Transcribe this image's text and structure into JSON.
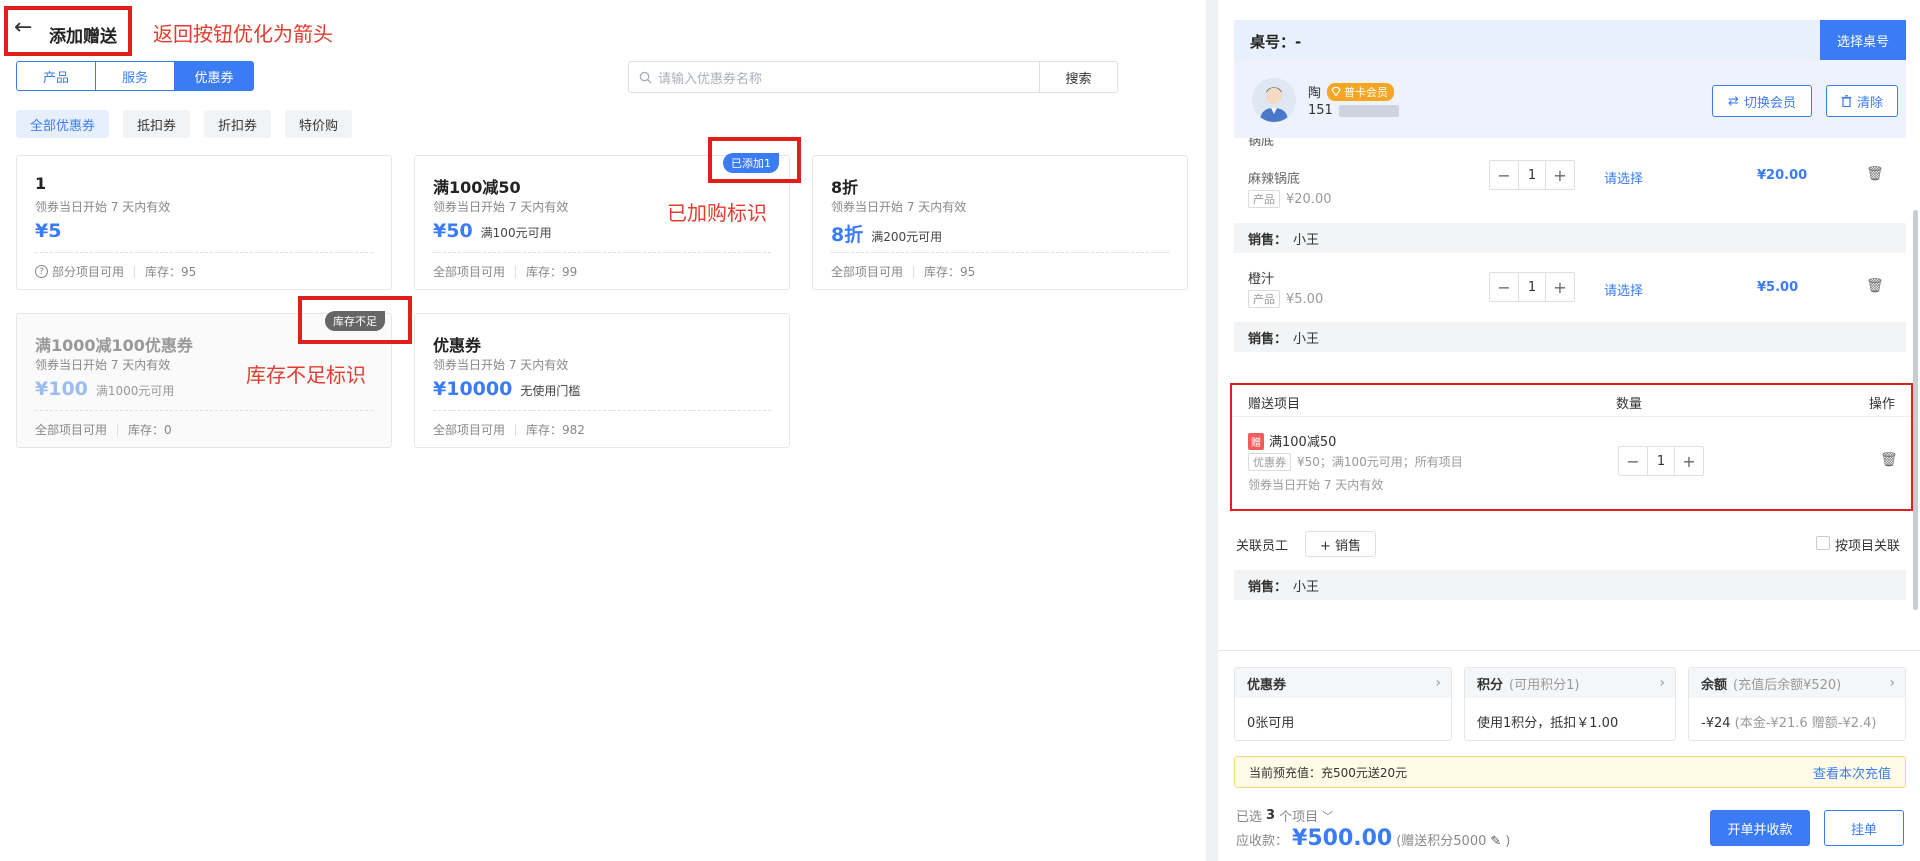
{
  "header": {
    "back_arrow": "←",
    "title": "添加赠送"
  },
  "annotations": {
    "back": "返回按钮优化为箭头",
    "added": "已加购标识",
    "stock": "库存不足标识"
  },
  "tabs": [
    {
      "label": "产品"
    },
    {
      "label": "服务"
    },
    {
      "label": "优惠券",
      "active": true
    }
  ],
  "search": {
    "placeholder": "请输入优惠券名称",
    "button": "搜索"
  },
  "filters": [
    {
      "label": "全部优惠券",
      "active": true
    },
    {
      "label": "抵扣券"
    },
    {
      "label": "折扣券"
    },
    {
      "label": "特价购"
    }
  ],
  "coupons": [
    {
      "title": "1",
      "sub": "领券当日开始 7 天内有效",
      "amount": "¥5",
      "cond": "",
      "scope": "部分项目可用",
      "stock": "库存：95",
      "scope_icon": "question-icon"
    },
    {
      "title": "满100减50",
      "sub": "领券当日开始 7 天内有效",
      "amount": "¥50",
      "cond": "满100元可用",
      "scope": "全部项目可用",
      "stock": "库存：99",
      "badge": "已添加1"
    },
    {
      "title": "8折",
      "sub": "领券当日开始 7 天内有效",
      "amount": "8折",
      "cond": "满200元可用",
      "scope": "全部项目可用",
      "stock": "库存：95"
    },
    {
      "title": "满1000减100优惠券",
      "sub": "领券当日开始 7 天内有效",
      "amount": "¥100",
      "cond": "满1000元可用",
      "scope": "全部项目可用",
      "stock": "库存：0",
      "badge": "库存不足",
      "disabled": true
    },
    {
      "title": "优惠券",
      "sub": "领券当日开始 7 天内有效",
      "amount": "¥10000",
      "cond": "无使用门槛",
      "scope": "全部项目可用",
      "stock": "库存：982"
    }
  ],
  "right": {
    "table_label": "桌号：-",
    "select_table": "选择桌号",
    "member": {
      "name": "陶",
      "level": "普卡会员",
      "phone": "151",
      "switch": "切换会员",
      "clear": "清除"
    },
    "items": [
      {
        "cut_title": "锅底",
        "name": "麻辣锅底",
        "tag": "产品",
        "price": "¥20.00",
        "qty": "1",
        "select": "请选择",
        "total": "¥20.00",
        "sales": "销售：",
        "seller": "小王"
      },
      {
        "name": "橙汁",
        "tag": "产品",
        "price": "¥5.00",
        "qty": "1",
        "select": "请选择",
        "total": "¥5.00",
        "sales": "销售：",
        "seller": "小王"
      }
    ],
    "gift": {
      "col_item": "赠送项目",
      "col_qty": "数量",
      "col_op": "操作",
      "badge": "赠",
      "name": "满100减50",
      "tag": "优惠券",
      "detail": "¥50；满100元可用；所有项目",
      "validity": "领券当日开始 7 天内有效",
      "qty": "1"
    },
    "staff": {
      "label": "关联员工",
      "add": "+ 销售",
      "by_item": "按项目关联",
      "sales": "销售：",
      "seller": "小王"
    },
    "boxes": [
      {
        "title": "优惠券",
        "extra": "",
        "body": "0张可用"
      },
      {
        "title": "积分",
        "extra": "(可用积分1)",
        "body": "使用1积分，抵扣￥1.00"
      },
      {
        "title": "余额",
        "extra": "(充值后余额¥520)",
        "body": "-¥24",
        "body_extra": "(本金-¥21.6 赠额-¥2.4)"
      }
    ],
    "notice": {
      "text": "当前预充值：充500元送20元",
      "link": "查看本次充值"
    },
    "summary": {
      "selected_pre": "已选",
      "selected_num": "3",
      "selected_post": "个项目",
      "due_label": "应收款：",
      "due": "¥500.00",
      "points": "(赠送积分5000",
      "points_end": ")"
    },
    "buttons": {
      "checkout": "开单并收款",
      "hold": "挂单"
    }
  },
  "colors": {
    "primary": "#3b7cf5",
    "annotation": "#e21f1a",
    "vip": "#f5a623"
  }
}
